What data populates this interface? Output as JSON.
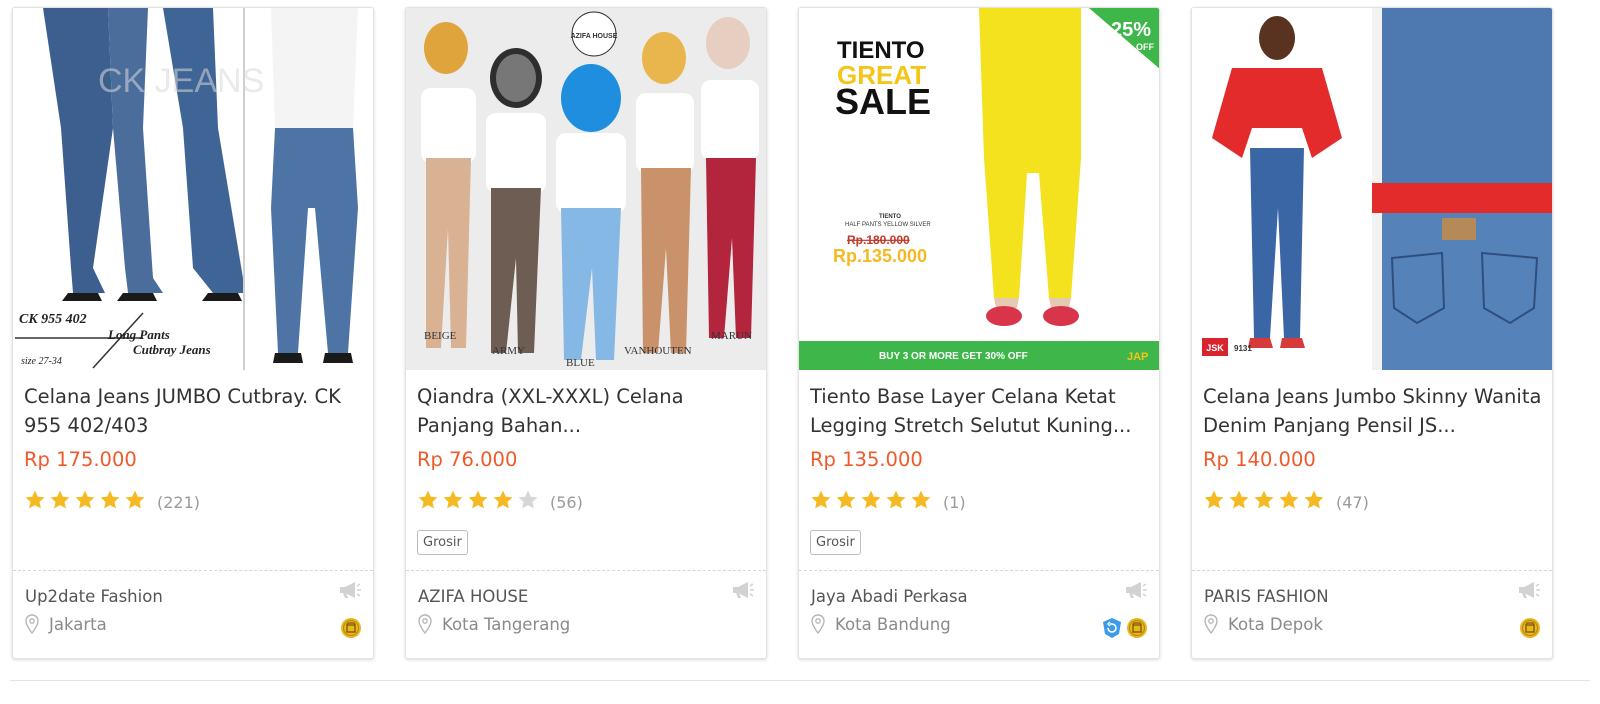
{
  "products": [
    {
      "title": "Celana Jeans JUMBO Cutbray. CK 955 402/403",
      "price": "Rp 175.000",
      "rating": 5,
      "reviews": "(221)",
      "badge": "",
      "shop": "Up2date Fashion",
      "location": "Jakarta",
      "image_text": {
        "code": "CK 955 402",
        "line1": "Long Pants",
        "line2": "Cutbray Jeans",
        "size": "size 27-34"
      },
      "trust_icons": [
        "gold-merchant-icon"
      ]
    },
    {
      "title": "Qiandra (XXL-XXXL) Celana Panjang Bahan...",
      "price": "Rp 76.000",
      "rating": 4,
      "reviews": "(56)",
      "badge": "Grosir",
      "shop": "AZIFA HOUSE",
      "location": "Kota Tangerang",
      "image_text": {
        "logo": "AZIFA HOUSE",
        "labels": [
          "BEIGE",
          "ARMY",
          "BLUE",
          "VANHOUTEN",
          "MARUN"
        ]
      },
      "trust_icons": []
    },
    {
      "title": "Tiento Base Layer Celana Ketat Legging Stretch Selutut Kuning...",
      "price": "Rp 135.000",
      "rating": 5,
      "reviews": "(1)",
      "badge": "Grosir",
      "shop": "Jaya Abadi Perkasa",
      "location": "Kota Bandung",
      "image_text": {
        "brand": "TIENTO",
        "great": "GREAT",
        "sale": "SALE",
        "discount": "25%",
        "off": "OFF",
        "product": "TIENTO",
        "product_sub": "HALF PANTS YELLOW SILVER",
        "old_price": "Rp.180.000",
        "new_price": "Rp.135.000",
        "promo": "BUY 3 OR MORE GET 30% OFF",
        "logo": "JAP"
      },
      "trust_icons": [
        "return-policy-icon",
        "gold-merchant-icon"
      ]
    },
    {
      "title": "Celana Jeans Jumbo Skinny Wanita Denim Panjang Pensil JS...",
      "price": "Rp 140.000",
      "rating": 5,
      "reviews": "(47)",
      "badge": "",
      "shop": "PARIS FASHION",
      "location": "Kota Depok",
      "image_text": {
        "tag_brand": "JSK",
        "tag_code": "9131"
      },
      "trust_icons": [
        "gold-merchant-icon"
      ]
    }
  ],
  "colors": {
    "price": "#f05a2a",
    "star": "#f5b921",
    "star_empty": "#d6d6d6",
    "promo_green": "#3fb64a",
    "sale_yellow": "#f5c518"
  },
  "icons": {
    "star": "star-icon",
    "location": "location-pin-icon",
    "promote": "megaphone-icon"
  }
}
